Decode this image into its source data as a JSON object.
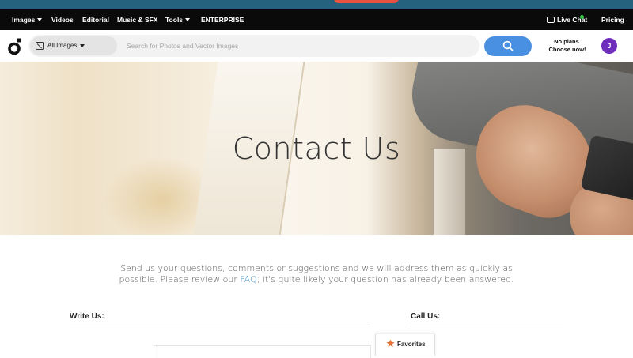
{
  "nav": {
    "items": [
      {
        "label": "Images",
        "dropdown": true
      },
      {
        "label": "Videos",
        "dropdown": false
      },
      {
        "label": "Editorial",
        "dropdown": false
      },
      {
        "label": "Music & SFX",
        "dropdown": false
      },
      {
        "label": "Tools",
        "dropdown": true
      },
      {
        "label": "ENTERPRISE",
        "dropdown": false
      }
    ],
    "live_chat": "Live Chat",
    "pricing": "Pricing"
  },
  "search": {
    "category": "All Images",
    "placeholder": "Search for Photos and Vector Images",
    "value": ""
  },
  "account": {
    "plan_line1": "No plans.",
    "plan_line2": "Choose now!",
    "avatar_initial": "J"
  },
  "hero": {
    "title": "Contact Us"
  },
  "intro": {
    "text_before": "Send us your questions, comments or suggestions and we will address them as quickly as possible. Please review our ",
    "link": "FAQ",
    "text_after": "; it's quite likely your question has already been answered."
  },
  "sections": {
    "write_us": "Write Us:",
    "call_us": "Call Us:"
  },
  "favorites": {
    "label": "Favorites"
  },
  "colors": {
    "accent": "#4a90e2",
    "avatar": "#6f2dbd",
    "link": "#3a96d6",
    "online": "#2ecc40",
    "navbar": "#0a0a0a",
    "star": "#e2763a"
  }
}
